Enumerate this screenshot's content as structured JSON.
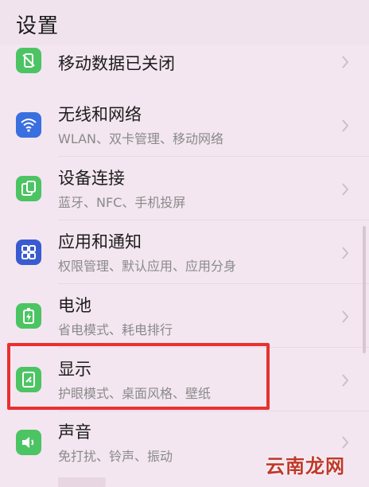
{
  "header": {
    "title": "设置"
  },
  "items": [
    {
      "label": "移动数据已关闭",
      "sub": "",
      "icon": "mobile-data-off-icon",
      "color": "#4cc463"
    },
    {
      "label": "无线和网络",
      "sub": "WLAN、双卡管理、移动网络",
      "icon": "wifi-icon",
      "color": "#3a6fe0"
    },
    {
      "label": "设备连接",
      "sub": "蓝牙、NFC、手机投屏",
      "icon": "device-connection-icon",
      "color": "#4cc463"
    },
    {
      "label": "应用和通知",
      "sub": "权限管理、默认应用、应用分身",
      "icon": "apps-icon",
      "color": "#3a5bd0"
    },
    {
      "label": "电池",
      "sub": "省电模式、耗电排行",
      "icon": "battery-icon",
      "color": "#4cc463"
    },
    {
      "label": "显示",
      "sub": "护眼模式、桌面风格、壁纸",
      "icon": "display-icon",
      "color": "#4cc463"
    },
    {
      "label": "声音",
      "sub": "免打扰、铃声、振动",
      "icon": "sound-icon",
      "color": "#4cc463"
    }
  ],
  "highlight_color": "#e8312f",
  "watermark": "云南龙网"
}
